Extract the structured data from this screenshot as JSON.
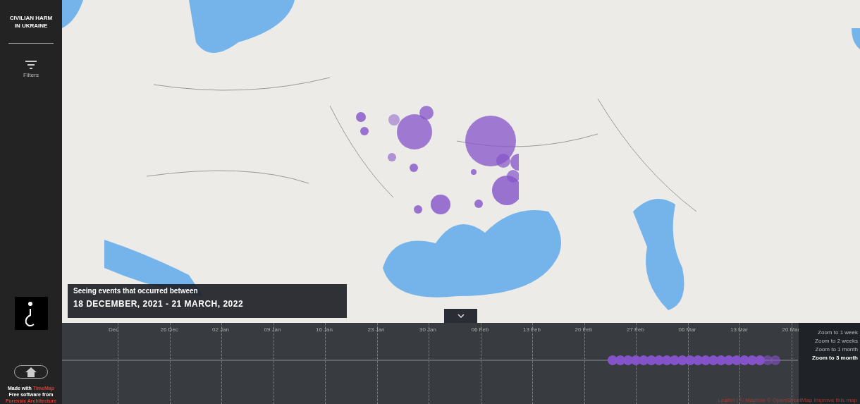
{
  "sidebar": {
    "title": "CIVILIAN HARM\nIN UKRAINE",
    "tabs": [
      {
        "label": "Filters",
        "selected": false
      }
    ],
    "credit": {
      "prefix": "Made with",
      "tool_link": "TimeMap",
      "middle": "Free software from",
      "org_link": "Forensic Architecture"
    }
  },
  "info_box": {
    "caption": "Seeing events that occurred between",
    "range": "18 DECEMBER, 2021 - 21 MARCH, 2022"
  },
  "timeline": {
    "expanded": true,
    "ticks": [
      "Dec",
      "26 Dec",
      "02 Jan",
      "09 Jan",
      "16 Jan",
      "23 Jan",
      "30 Jan",
      "06 Feb",
      "13 Feb",
      "20 Feb",
      "27 Feb",
      "06 Mar",
      "13 Mar",
      "20 Mar"
    ],
    "zoom_options": [
      {
        "label": "Zoom to 1 week",
        "selected": false
      },
      {
        "label": "Zoom to 2 weeks",
        "selected": false
      },
      {
        "label": "Zoom to 1 month",
        "selected": false
      },
      {
        "label": "Zoom to 3 month",
        "selected": true
      }
    ]
  },
  "attribution": "Leaflet | © Mapbox © OpenStreetMap Improve this map"
}
